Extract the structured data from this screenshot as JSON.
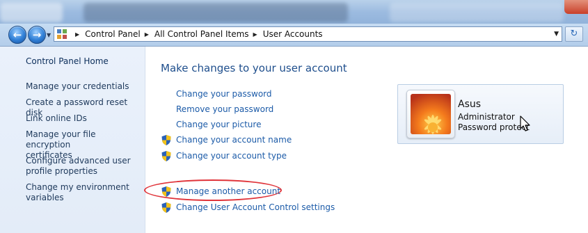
{
  "breadcrumb": {
    "items": [
      "Control Panel",
      "All Control Panel Items",
      "User Accounts"
    ]
  },
  "sidebar": {
    "home": "Control Panel Home",
    "links": [
      [
        "Manage your credentials"
      ],
      [
        "Create a password reset disk"
      ],
      [
        "Link online IDs"
      ],
      [
        "Manage your file encryption",
        "certificates"
      ],
      [
        "Configure advanced user",
        "profile properties"
      ],
      [
        "Change my environment",
        "variables"
      ]
    ]
  },
  "main": {
    "title": "Make changes to your user account",
    "tasks": [
      "Change your password",
      "Remove your password",
      "Change your picture",
      "Change your account name",
      "Change your account type",
      "Manage another account",
      "Change User Account Control settings"
    ]
  },
  "account": {
    "name": "Asus",
    "role": "Administrator",
    "password_status": "Password protect"
  },
  "colors": {
    "link": "#1c5ba8",
    "title": "#1e4e8c",
    "highlight": "#e0343a",
    "sidebar_bg": "#e8f0fa"
  },
  "icons": {
    "back": "back-arrow-icon",
    "forward": "forward-arrow-icon",
    "refresh": "refresh-icon",
    "shield": "uac-shield-icon"
  }
}
